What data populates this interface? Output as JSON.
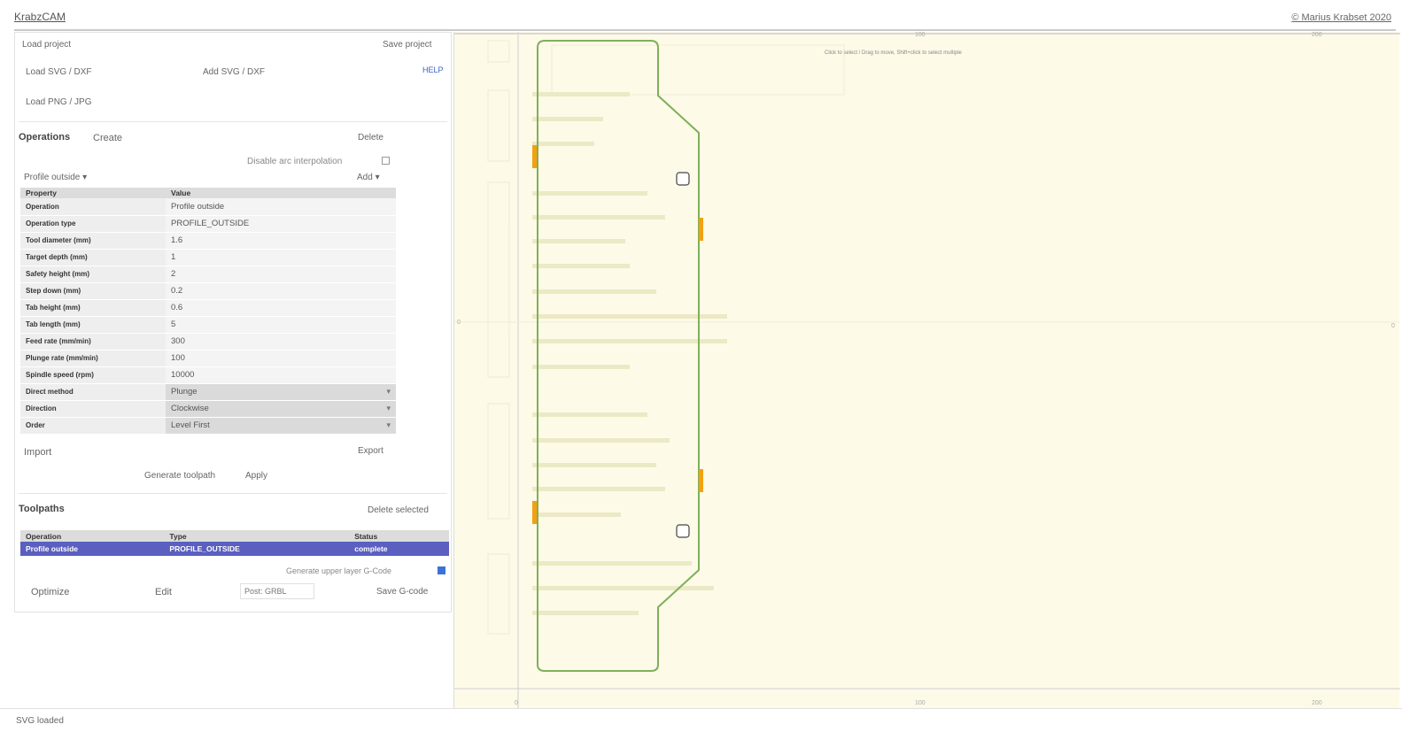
{
  "app": {
    "title": "KrabzCAM",
    "copyright": "© Marius Krabset 2020"
  },
  "project": {
    "load_project": "Load project",
    "save_project": "Save project",
    "load_svg": "Load SVG / DXF",
    "add_svg": "Add SVG / DXF",
    "help": "HELP",
    "load_png": "Load PNG / JPG"
  },
  "operations": {
    "heading": "Operations",
    "create": "Create",
    "delete": "Delete",
    "disable_arc_label": "Disable arc interpolation",
    "selected": "Profile outside",
    "add": "Add",
    "col_property": "Property",
    "col_value": "Value",
    "rows": [
      {
        "key": "Operation",
        "value": "Profile outside"
      },
      {
        "key": "Operation type",
        "value": "PROFILE_OUTSIDE"
      },
      {
        "key": "Tool diameter (mm)",
        "value": "1.6"
      },
      {
        "key": "Target depth (mm)",
        "value": "1"
      },
      {
        "key": "Safety height (mm)",
        "value": "2"
      },
      {
        "key": "Step down (mm)",
        "value": "0.2"
      },
      {
        "key": "Tab height (mm)",
        "value": "0.6"
      },
      {
        "key": "Tab length (mm)",
        "value": "5"
      },
      {
        "key": "Feed rate (mm/min)",
        "value": "300"
      },
      {
        "key": "Plunge rate (mm/min)",
        "value": "100"
      },
      {
        "key": "Spindle speed (rpm)",
        "value": "10000"
      }
    ],
    "select_rows": [
      {
        "key": "Direct method",
        "value": "Plunge"
      },
      {
        "key": "Direction",
        "value": "Clockwise"
      },
      {
        "key": "Order",
        "value": "Level First"
      }
    ],
    "import": "Import",
    "export": "Export",
    "generate_toolpath": "Generate toolpath",
    "apply": "Apply"
  },
  "toolpaths": {
    "heading": "Toolpaths",
    "delete_selected": "Delete selected",
    "col_operation": "Operation",
    "col_type": "Type",
    "col_status": "Status",
    "rows": [
      {
        "operation": "Profile outside",
        "type": "PROFILE_OUTSIDE",
        "status": "complete"
      }
    ],
    "upper_layer_label": "Generate upper layer G-Code",
    "optimize": "Optimize",
    "edit": "Edit",
    "post_placeholder": "Post: GRBL",
    "save_gcode": "Save G-code"
  },
  "canvas": {
    "hint": "Click to select / Drag to move, Shift+click to select multiple",
    "top_ticks": [
      "100",
      "200"
    ],
    "bottom_ticks": [
      "0",
      "100",
      "200"
    ],
    "left_tick": "0",
    "right_tick": "0"
  },
  "status": {
    "text": "SVG loaded"
  },
  "colors": {
    "canvas_bg": "#fdfae8",
    "board_outline": "#7fb05a",
    "tab_marker": "#f4a010",
    "selection": "#5a5fc0"
  }
}
